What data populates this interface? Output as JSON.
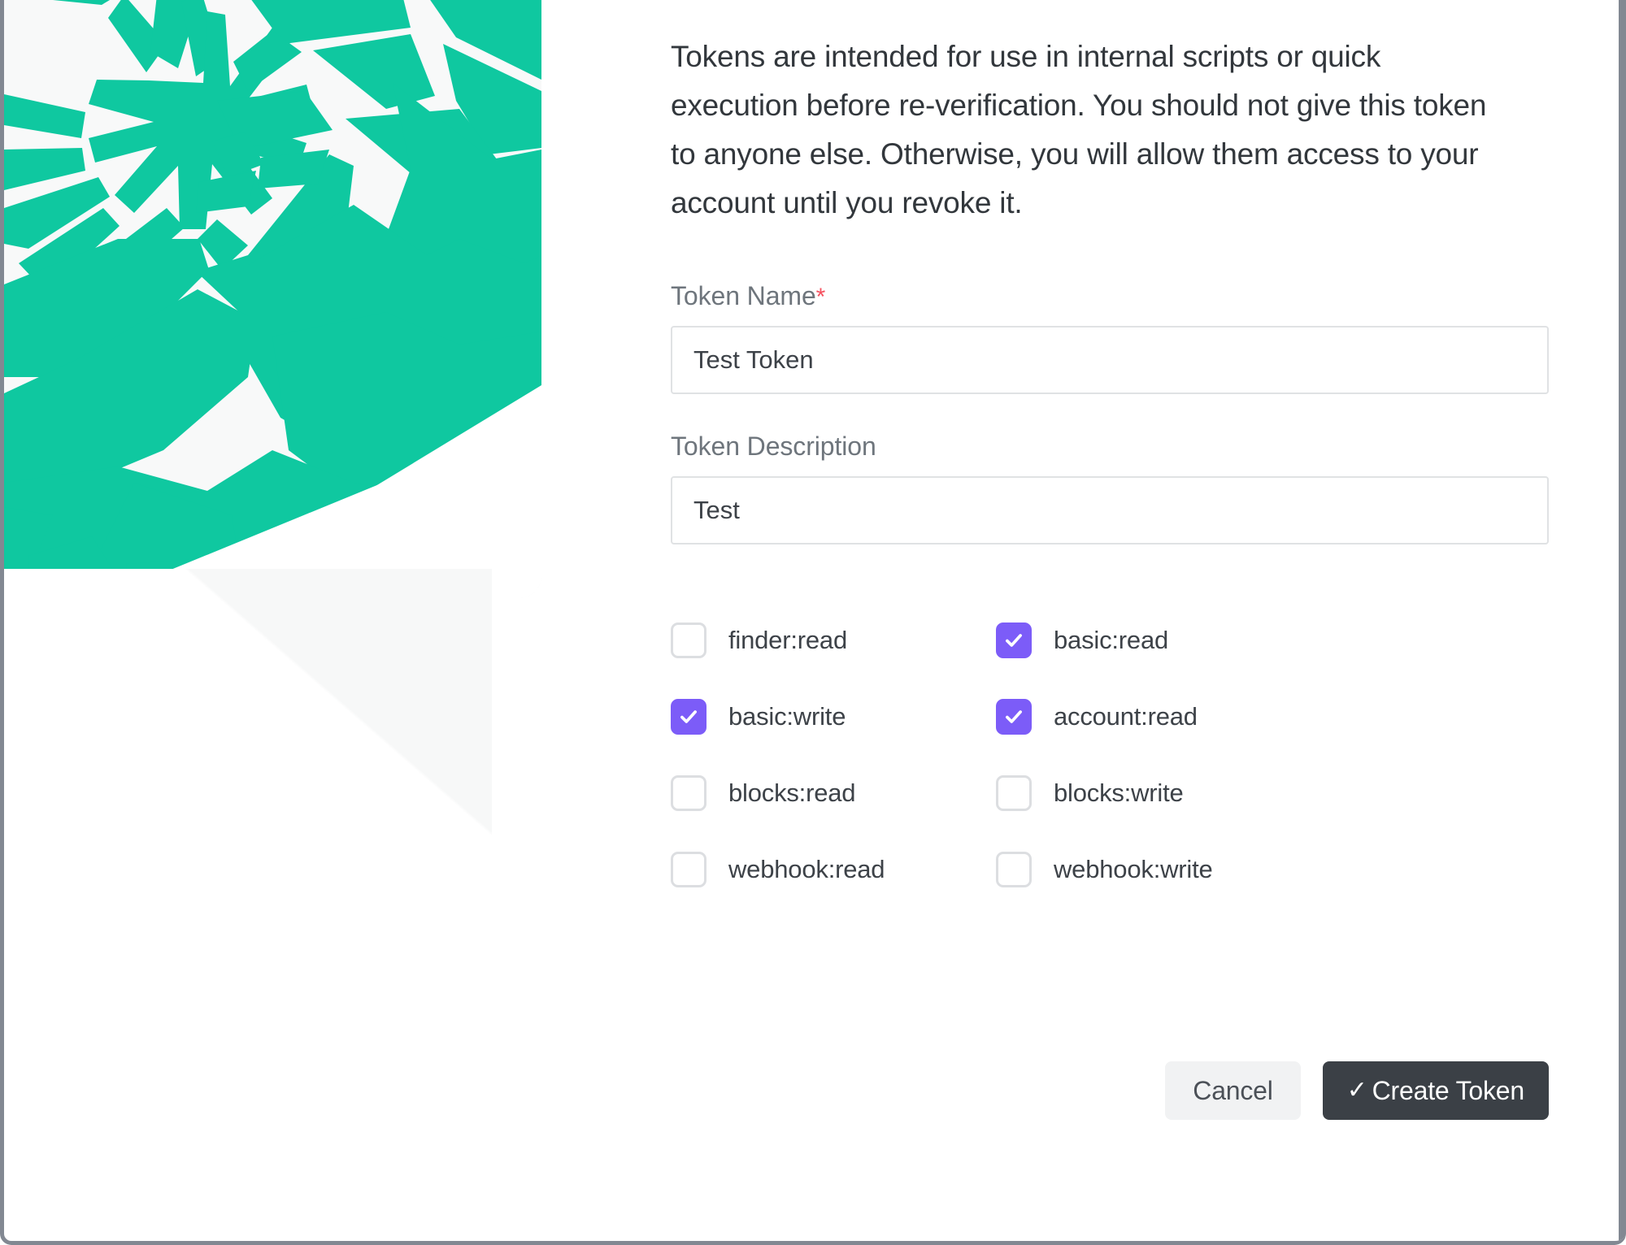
{
  "dialog": {
    "intro_text": "Tokens are intended for use in internal scripts or quick execution before re-verification. You should not give this token to anyone else. Otherwise, you will allow them access to your account until you revoke it.",
    "accent_green": "#0FC8A0",
    "accent_purple": "#7C5CF8",
    "required_star_color": "#F5515F"
  },
  "fields": {
    "token_name": {
      "label": "Token Name",
      "required_marker": "*",
      "value": "Test Token",
      "placeholder": "Token Name"
    },
    "token_description": {
      "label": "Token Description",
      "value": "Test",
      "placeholder": "Token Description"
    }
  },
  "scopes": [
    {
      "label": "finder:read",
      "checked": false
    },
    {
      "label": "basic:read",
      "checked": true
    },
    {
      "label": "basic:write",
      "checked": true
    },
    {
      "label": "account:read",
      "checked": true
    },
    {
      "label": "blocks:read",
      "checked": false
    },
    {
      "label": "blocks:write",
      "checked": false
    },
    {
      "label": "webhook:read",
      "checked": false
    },
    {
      "label": "webhook:write",
      "checked": false
    }
  ],
  "actions": {
    "cancel_label": "Cancel",
    "create_label": "Create Token",
    "create_icon": "✓"
  }
}
